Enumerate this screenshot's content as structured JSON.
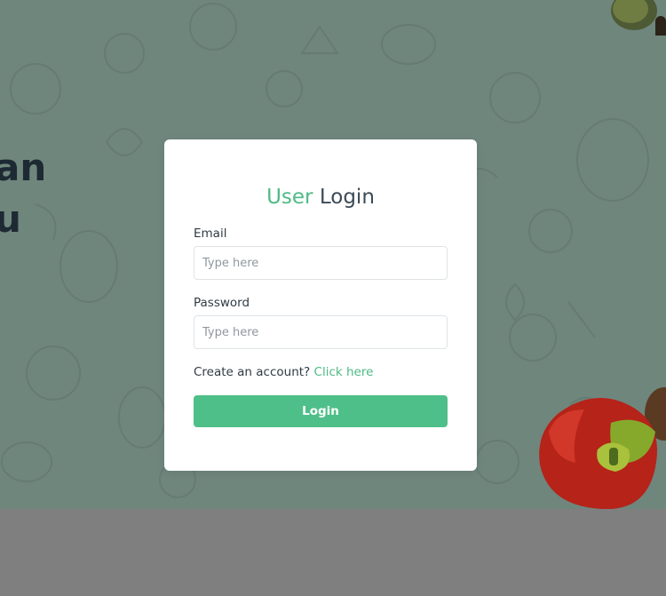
{
  "hero": {
    "heading_line1": "an",
    "heading_line2": "u"
  },
  "login_modal": {
    "title_accent": "User",
    "title_rest": "Login",
    "email_label": "Email",
    "email_placeholder": "Type here",
    "email_value": "",
    "password_label": "Password",
    "password_placeholder": "Type here",
    "password_value": "",
    "create_account_text": "Create an account?",
    "create_account_link": "Click here",
    "login_button": "Login"
  },
  "colors": {
    "accent": "#4fba86",
    "button": "#4fbf89",
    "overlay_hero": "#6f867d",
    "overlay_bottom": "#7f7f7f",
    "title_text": "#3c4a57"
  },
  "icons": [
    "vegetable-pattern",
    "pepper-image",
    "cucumber-image",
    "eggplant-image"
  ]
}
